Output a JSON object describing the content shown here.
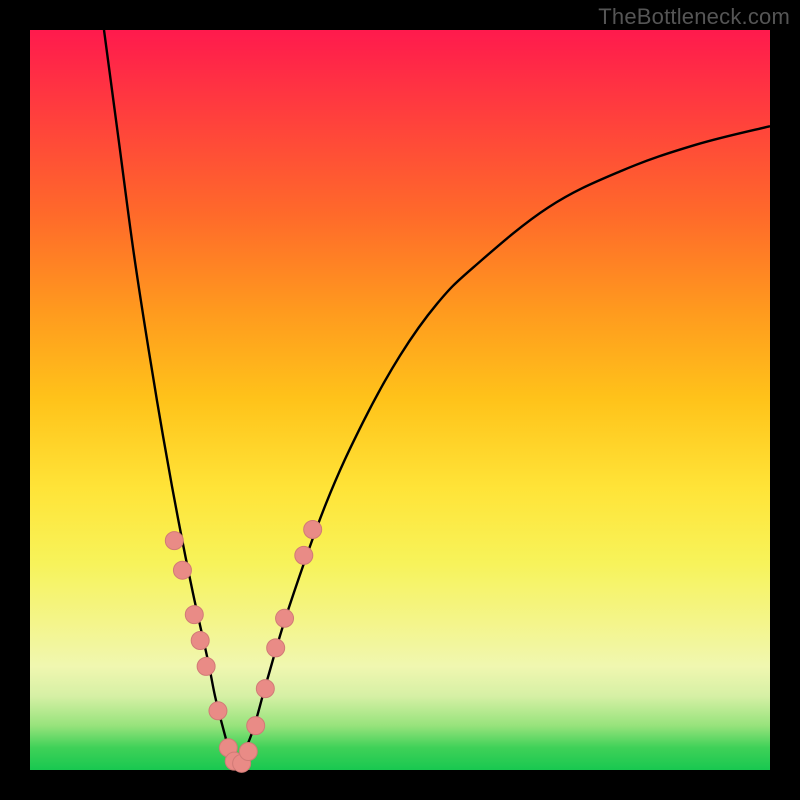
{
  "watermark": "TheBottleneck.com",
  "colors": {
    "curve": "#000000",
    "dot_fill": "#e98b86",
    "dot_stroke": "#d17a76",
    "gradient_top": "#ff1a4d",
    "gradient_bottom": "#18c850"
  },
  "chart_data": {
    "type": "line",
    "title": "",
    "xlabel": "",
    "ylabel": "",
    "xlim": [
      0,
      100
    ],
    "ylim": [
      0,
      100
    ],
    "grid": false,
    "legend": false,
    "series": [
      {
        "name": "left-branch",
        "x": [
          10,
          12,
          14,
          16,
          18,
          20,
          22,
          24,
          25,
          26,
          27,
          28
        ],
        "values": [
          100,
          85,
          70,
          57,
          45,
          34,
          24,
          15,
          10,
          6,
          2.5,
          0.5
        ]
      },
      {
        "name": "right-branch",
        "x": [
          28,
          30,
          32,
          35,
          40,
          45,
          50,
          55,
          60,
          70,
          80,
          90,
          100
        ],
        "values": [
          0.5,
          5,
          12,
          22,
          36,
          47,
          56,
          63,
          68,
          76,
          81,
          84.5,
          87
        ]
      }
    ],
    "dots": [
      {
        "x": 19.5,
        "y": 31
      },
      {
        "x": 20.6,
        "y": 27
      },
      {
        "x": 22.2,
        "y": 21
      },
      {
        "x": 23.0,
        "y": 17.5
      },
      {
        "x": 23.8,
        "y": 14
      },
      {
        "x": 25.4,
        "y": 8
      },
      {
        "x": 26.8,
        "y": 3
      },
      {
        "x": 27.6,
        "y": 1.2
      },
      {
        "x": 28.6,
        "y": 0.9
      },
      {
        "x": 29.5,
        "y": 2.5
      },
      {
        "x": 30.5,
        "y": 6
      },
      {
        "x": 31.8,
        "y": 11
      },
      {
        "x": 33.2,
        "y": 16.5
      },
      {
        "x": 34.4,
        "y": 20.5
      },
      {
        "x": 37.0,
        "y": 29
      },
      {
        "x": 38.2,
        "y": 32.5
      }
    ],
    "dot_radius_px": 9
  }
}
